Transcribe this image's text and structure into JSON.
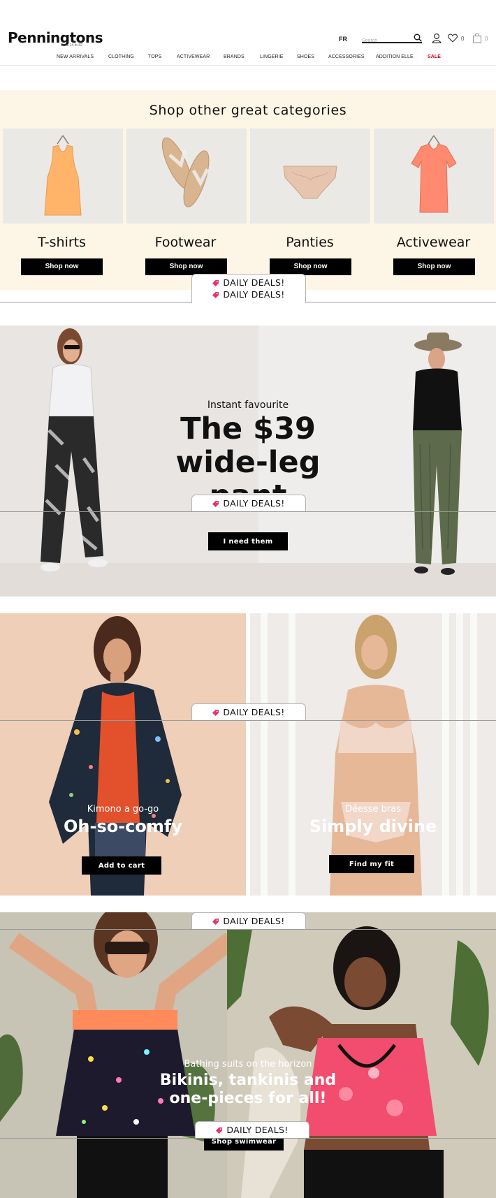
{
  "header": {
    "logo": "Penningtons",
    "logo_sub": "sizes 14 to 32",
    "lang": "FR",
    "search_placeholder": "Search",
    "wishlist_count": "0",
    "cart_count": "0"
  },
  "nav": [
    "NEW ARRIVALS",
    "CLOTHING",
    "TOPS",
    "ACTIVEWEAR",
    "BRANDS",
    "LINGERIE",
    "SHOES",
    "ACCESSORIES",
    "ADDITION ELLE",
    "SALE"
  ],
  "categories": {
    "title": "Shop other great categories",
    "items": [
      {
        "name": "T-shirts",
        "button": "Shop now",
        "color": "#ffb46a"
      },
      {
        "name": "Footwear",
        "button": "Shop now",
        "color": "#d8b58e"
      },
      {
        "name": "Panties",
        "button": "Shop now",
        "color": "#e6c4ae"
      },
      {
        "name": "Activewear",
        "button": "Shop now",
        "color": "#ff8a70"
      }
    ]
  },
  "daily_deals": "DAILY DEALS!",
  "hero1": {
    "eyebrow": "Instant favourite",
    "headline_1": "The $39",
    "headline_2": "wide-leg",
    "headline_3": "pant",
    "button": "I need them"
  },
  "split1": {
    "left": {
      "eyebrow": "Kimono a go-go",
      "headline": "Oh-so-comfy",
      "button": "Add to cart"
    },
    "right": {
      "eyebrow": "Déesse bras",
      "headline": "Simply divine",
      "button": "Find my fit"
    }
  },
  "swim": {
    "eyebrow": "Bathing suits on the horizon",
    "headline_1": "Bikinis, tankinis and",
    "headline_2": "one-pieces for all!",
    "button": "Shop swimwear"
  },
  "colors": {
    "cream": "#fdf6e6",
    "sale_red": "#d0021b",
    "deal_pink": "#e8336d"
  }
}
